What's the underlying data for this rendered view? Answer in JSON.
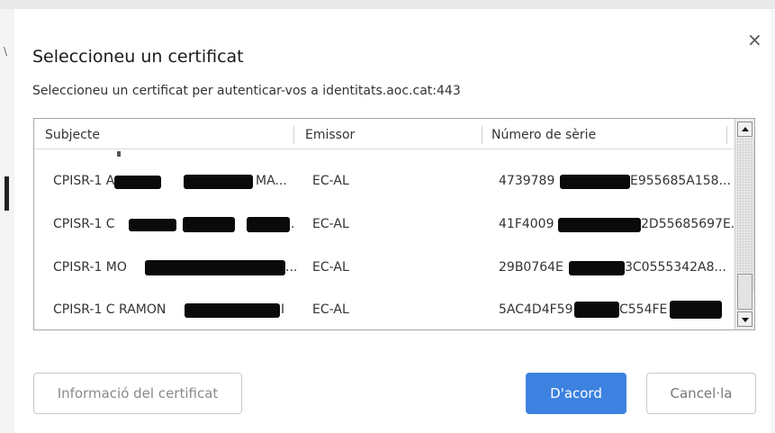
{
  "dialog": {
    "title": "Seleccioneu un certificat",
    "subtitle": "Seleccioneu un certificat per autenticar-vos a identitats.aoc.cat:443",
    "close_glyph": "×"
  },
  "table": {
    "headers": {
      "subject": "Subjecte",
      "issuer": "Emissor",
      "serial": "Número de sèrie"
    },
    "rows": [
      {
        "subject": "CPISR-1 A",
        "subject_tail": "MA...",
        "issuer": "EC-AL",
        "serial": "4739789",
        "serial_tail": "E955685A158..."
      },
      {
        "subject": "CPISR-1 C",
        "subject_tail": ".",
        "issuer": "EC-AL",
        "serial": "41F4009",
        "serial_tail": "2D55685697E..."
      },
      {
        "subject": "CPISR-1 MO",
        "subject_tail": "...",
        "issuer": "EC-AL",
        "serial": "29B0764E",
        "serial_tail": "3C0555342A8..."
      },
      {
        "subject": "CPISR-1 C RAMON",
        "subject_tail": "I",
        "issuer": "EC-AL",
        "serial": "5AC4D4F59",
        "serial_tail": "C554FE"
      }
    ]
  },
  "buttons": {
    "info": "Informació del certificat",
    "ok": "D'acord",
    "cancel": "Cancel·la"
  },
  "colors": {
    "accent": "#3d82e0"
  },
  "icons": {
    "close": "close-icon",
    "scroll_up": "chevron-up-icon",
    "scroll_down": "chevron-down-icon"
  }
}
